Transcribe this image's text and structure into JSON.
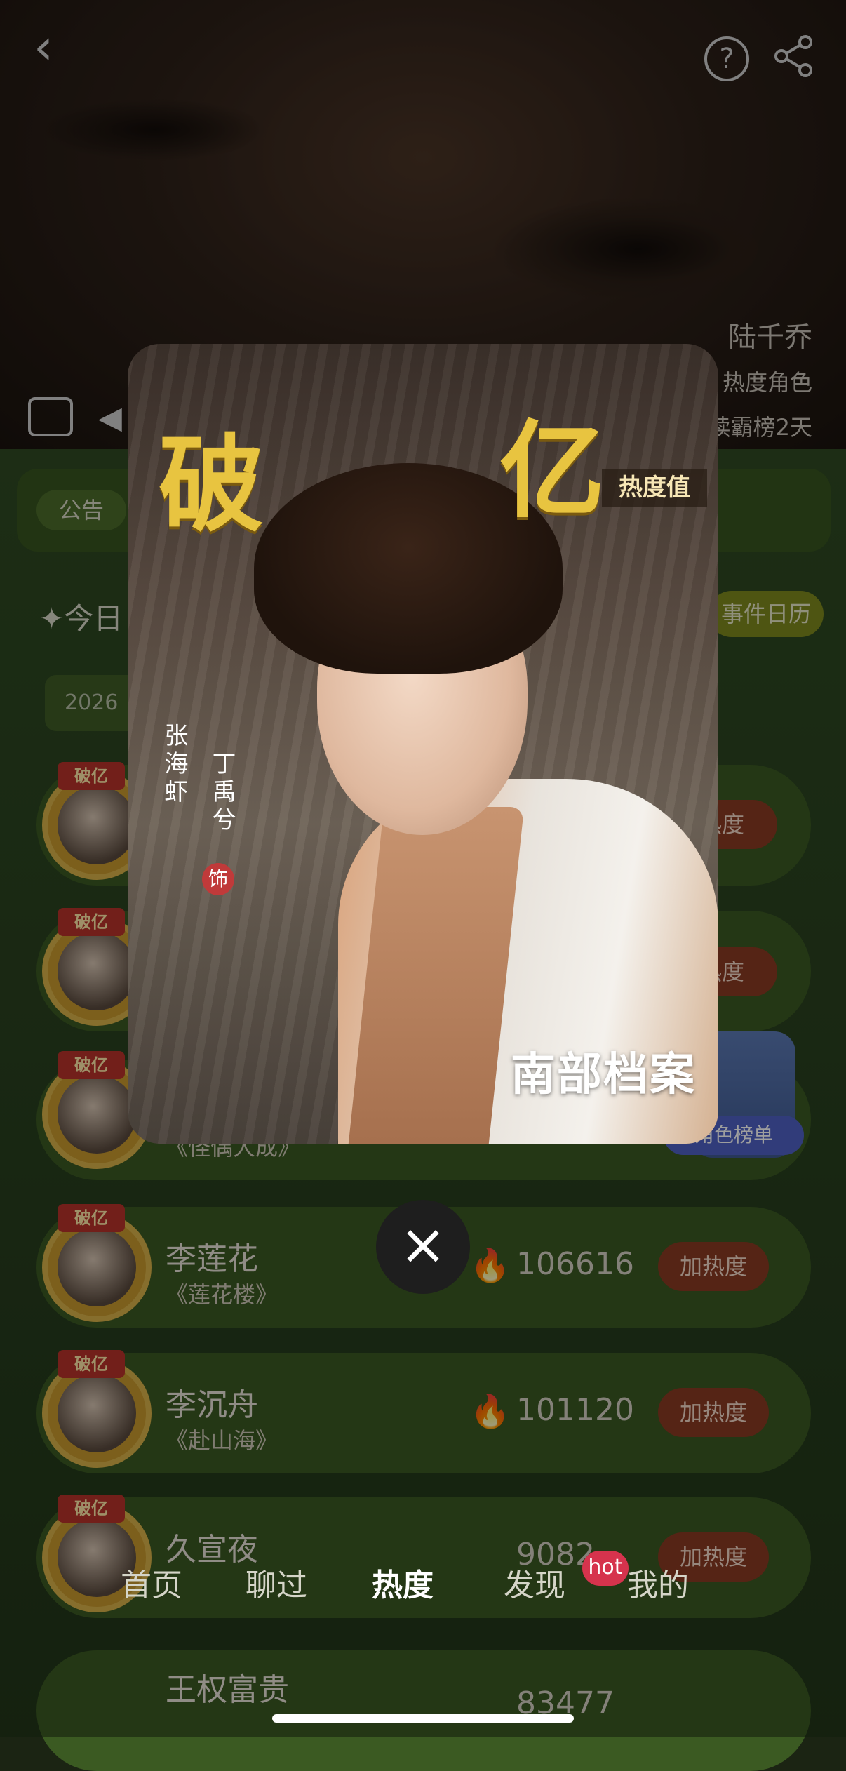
{
  "header": {
    "character_name": "陆千乔",
    "line2": "热度角色",
    "line3": "读霸榜2天"
  },
  "background": {
    "notice_label": "公告",
    "today_label": "✦今日",
    "date_fragment": "2026",
    "calendar_label": "事件日历",
    "badge_text": "破亿",
    "side_badge_label": "角色榜单"
  },
  "rank_items": [
    {
      "name": "",
      "show": "",
      "score": "",
      "boost": "热度"
    },
    {
      "name": "",
      "show": "",
      "score": "",
      "boost": "热度"
    },
    {
      "name": "",
      "show": "《怪偶大成》",
      "score": "",
      "boost": ""
    },
    {
      "name": "李莲花",
      "show": "《莲花楼》",
      "score": "106616",
      "boost": "加热度"
    },
    {
      "name": "李沉舟",
      "show": "《赴山海》",
      "score": "101120",
      "boost": "加热度"
    },
    {
      "name": "久宣夜",
      "show": "",
      "score": "9082",
      "boost": "加热度"
    },
    {
      "name": "王权富贵",
      "show": "",
      "score": "83477",
      "boost": ""
    }
  ],
  "popup": {
    "title_left": "破",
    "title_right": "亿",
    "heat_tag": "热度值",
    "actor": "张海虾",
    "role": "丁禹兮",
    "seal": "饰",
    "show_logo": "南部档案"
  },
  "nav": {
    "items": [
      "首页",
      "聊过",
      "热度",
      "发现",
      "我的"
    ],
    "active": "热度",
    "hot_badge": "hot"
  },
  "icons": {
    "back": "back-arrow-icon",
    "help": "help-icon",
    "share": "share-icon",
    "close": "close-icon",
    "fire": "fire-icon"
  },
  "colors": {
    "gold_title": "#e8c440",
    "boost_button": "#8a3a22",
    "hot_badge": "#d6334d"
  }
}
